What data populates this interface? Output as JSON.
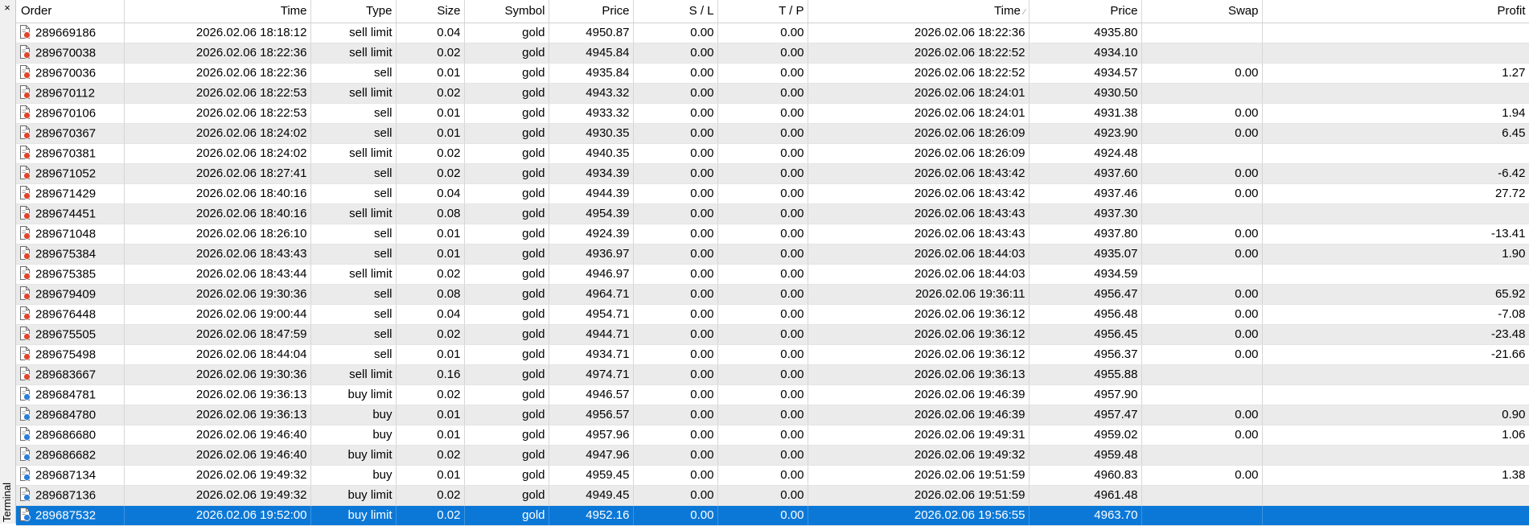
{
  "panel": {
    "close_glyph": "×",
    "side_label": "Terminal"
  },
  "colors": {
    "sell": "#e0462c",
    "buy": "#2b7fd6",
    "selected": "#0b78d7"
  },
  "columns": [
    "Order",
    "Time",
    "Type",
    "Size",
    "Symbol",
    "Price",
    "S / L",
    "T / P",
    "Time",
    "Price",
    "Swap",
    "Profit"
  ],
  "rows": [
    {
      "order": "289669186",
      "time": "2026.02.06 18:18:12",
      "type": "sell limit",
      "size": "0.04",
      "symbol": "gold",
      "price": "4950.87",
      "sl": "0.00",
      "tp": "0.00",
      "close_time": "2026.02.06 18:22:36",
      "close_price": "4935.80",
      "swap": "",
      "profit": "",
      "icon": "sell-order-icon"
    },
    {
      "order": "289670038",
      "time": "2026.02.06 18:22:36",
      "type": "sell limit",
      "size": "0.02",
      "symbol": "gold",
      "price": "4945.84",
      "sl": "0.00",
      "tp": "0.00",
      "close_time": "2026.02.06 18:22:52",
      "close_price": "4934.10",
      "swap": "",
      "profit": "",
      "icon": "sell-order-icon"
    },
    {
      "order": "289670036",
      "time": "2026.02.06 18:22:36",
      "type": "sell",
      "size": "0.01",
      "symbol": "gold",
      "price": "4935.84",
      "sl": "0.00",
      "tp": "0.00",
      "close_time": "2026.02.06 18:22:52",
      "close_price": "4934.57",
      "swap": "0.00",
      "profit": "1.27",
      "icon": "sell-order-icon"
    },
    {
      "order": "289670112",
      "time": "2026.02.06 18:22:53",
      "type": "sell limit",
      "size": "0.02",
      "symbol": "gold",
      "price": "4943.32",
      "sl": "0.00",
      "tp": "0.00",
      "close_time": "2026.02.06 18:24:01",
      "close_price": "4930.50",
      "swap": "",
      "profit": "",
      "icon": "sell-order-icon"
    },
    {
      "order": "289670106",
      "time": "2026.02.06 18:22:53",
      "type": "sell",
      "size": "0.01",
      "symbol": "gold",
      "price": "4933.32",
      "sl": "0.00",
      "tp": "0.00",
      "close_time": "2026.02.06 18:24:01",
      "close_price": "4931.38",
      "swap": "0.00",
      "profit": "1.94",
      "icon": "sell-order-icon"
    },
    {
      "order": "289670367",
      "time": "2026.02.06 18:24:02",
      "type": "sell",
      "size": "0.01",
      "symbol": "gold",
      "price": "4930.35",
      "sl": "0.00",
      "tp": "0.00",
      "close_time": "2026.02.06 18:26:09",
      "close_price": "4923.90",
      "swap": "0.00",
      "profit": "6.45",
      "icon": "sell-order-icon"
    },
    {
      "order": "289670381",
      "time": "2026.02.06 18:24:02",
      "type": "sell limit",
      "size": "0.02",
      "symbol": "gold",
      "price": "4940.35",
      "sl": "0.00",
      "tp": "0.00",
      "close_time": "2026.02.06 18:26:09",
      "close_price": "4924.48",
      "swap": "",
      "profit": "",
      "icon": "sell-order-icon"
    },
    {
      "order": "289671052",
      "time": "2026.02.06 18:27:41",
      "type": "sell",
      "size": "0.02",
      "symbol": "gold",
      "price": "4934.39",
      "sl": "0.00",
      "tp": "0.00",
      "close_time": "2026.02.06 18:43:42",
      "close_price": "4937.60",
      "swap": "0.00",
      "profit": "-6.42",
      "icon": "sell-order-icon"
    },
    {
      "order": "289671429",
      "time": "2026.02.06 18:40:16",
      "type": "sell",
      "size": "0.04",
      "symbol": "gold",
      "price": "4944.39",
      "sl": "0.00",
      "tp": "0.00",
      "close_time": "2026.02.06 18:43:42",
      "close_price": "4937.46",
      "swap": "0.00",
      "profit": "27.72",
      "icon": "sell-order-icon"
    },
    {
      "order": "289674451",
      "time": "2026.02.06 18:40:16",
      "type": "sell limit",
      "size": "0.08",
      "symbol": "gold",
      "price": "4954.39",
      "sl": "0.00",
      "tp": "0.00",
      "close_time": "2026.02.06 18:43:43",
      "close_price": "4937.30",
      "swap": "",
      "profit": "",
      "icon": "sell-order-icon"
    },
    {
      "order": "289671048",
      "time": "2026.02.06 18:26:10",
      "type": "sell",
      "size": "0.01",
      "symbol": "gold",
      "price": "4924.39",
      "sl": "0.00",
      "tp": "0.00",
      "close_time": "2026.02.06 18:43:43",
      "close_price": "4937.80",
      "swap": "0.00",
      "profit": "-13.41",
      "icon": "sell-order-icon"
    },
    {
      "order": "289675384",
      "time": "2026.02.06 18:43:43",
      "type": "sell",
      "size": "0.01",
      "symbol": "gold",
      "price": "4936.97",
      "sl": "0.00",
      "tp": "0.00",
      "close_time": "2026.02.06 18:44:03",
      "close_price": "4935.07",
      "swap": "0.00",
      "profit": "1.90",
      "icon": "sell-order-icon"
    },
    {
      "order": "289675385",
      "time": "2026.02.06 18:43:44",
      "type": "sell limit",
      "size": "0.02",
      "symbol": "gold",
      "price": "4946.97",
      "sl": "0.00",
      "tp": "0.00",
      "close_time": "2026.02.06 18:44:03",
      "close_price": "4934.59",
      "swap": "",
      "profit": "",
      "icon": "sell-order-icon"
    },
    {
      "order": "289679409",
      "time": "2026.02.06 19:30:36",
      "type": "sell",
      "size": "0.08",
      "symbol": "gold",
      "price": "4964.71",
      "sl": "0.00",
      "tp": "0.00",
      "close_time": "2026.02.06 19:36:11",
      "close_price": "4956.47",
      "swap": "0.00",
      "profit": "65.92",
      "icon": "sell-order-icon"
    },
    {
      "order": "289676448",
      "time": "2026.02.06 19:00:44",
      "type": "sell",
      "size": "0.04",
      "symbol": "gold",
      "price": "4954.71",
      "sl": "0.00",
      "tp": "0.00",
      "close_time": "2026.02.06 19:36:12",
      "close_price": "4956.48",
      "swap": "0.00",
      "profit": "-7.08",
      "icon": "sell-order-icon"
    },
    {
      "order": "289675505",
      "time": "2026.02.06 18:47:59",
      "type": "sell",
      "size": "0.02",
      "symbol": "gold",
      "price": "4944.71",
      "sl": "0.00",
      "tp": "0.00",
      "close_time": "2026.02.06 19:36:12",
      "close_price": "4956.45",
      "swap": "0.00",
      "profit": "-23.48",
      "icon": "sell-order-icon"
    },
    {
      "order": "289675498",
      "time": "2026.02.06 18:44:04",
      "type": "sell",
      "size": "0.01",
      "symbol": "gold",
      "price": "4934.71",
      "sl": "0.00",
      "tp": "0.00",
      "close_time": "2026.02.06 19:36:12",
      "close_price": "4956.37",
      "swap": "0.00",
      "profit": "-21.66",
      "icon": "sell-order-icon"
    },
    {
      "order": "289683667",
      "time": "2026.02.06 19:30:36",
      "type": "sell limit",
      "size": "0.16",
      "symbol": "gold",
      "price": "4974.71",
      "sl": "0.00",
      "tp": "0.00",
      "close_time": "2026.02.06 19:36:13",
      "close_price": "4955.88",
      "swap": "",
      "profit": "",
      "icon": "sell-order-icon"
    },
    {
      "order": "289684781",
      "time": "2026.02.06 19:36:13",
      "type": "buy limit",
      "size": "0.02",
      "symbol": "gold",
      "price": "4946.57",
      "sl": "0.00",
      "tp": "0.00",
      "close_time": "2026.02.06 19:46:39",
      "close_price": "4957.90",
      "swap": "",
      "profit": "",
      "icon": "buy-order-icon"
    },
    {
      "order": "289684780",
      "time": "2026.02.06 19:36:13",
      "type": "buy",
      "size": "0.01",
      "symbol": "gold",
      "price": "4956.57",
      "sl": "0.00",
      "tp": "0.00",
      "close_time": "2026.02.06 19:46:39",
      "close_price": "4957.47",
      "swap": "0.00",
      "profit": "0.90",
      "icon": "buy-order-icon"
    },
    {
      "order": "289686680",
      "time": "2026.02.06 19:46:40",
      "type": "buy",
      "size": "0.01",
      "symbol": "gold",
      "price": "4957.96",
      "sl": "0.00",
      "tp": "0.00",
      "close_time": "2026.02.06 19:49:31",
      "close_price": "4959.02",
      "swap": "0.00",
      "profit": "1.06",
      "icon": "buy-order-icon"
    },
    {
      "order": "289686682",
      "time": "2026.02.06 19:46:40",
      "type": "buy limit",
      "size": "0.02",
      "symbol": "gold",
      "price": "4947.96",
      "sl": "0.00",
      "tp": "0.00",
      "close_time": "2026.02.06 19:49:32",
      "close_price": "4959.48",
      "swap": "",
      "profit": "",
      "icon": "buy-order-icon"
    },
    {
      "order": "289687134",
      "time": "2026.02.06 19:49:32",
      "type": "buy",
      "size": "0.01",
      "symbol": "gold",
      "price": "4959.45",
      "sl": "0.00",
      "tp": "0.00",
      "close_time": "2026.02.06 19:51:59",
      "close_price": "4960.83",
      "swap": "0.00",
      "profit": "1.38",
      "icon": "buy-order-icon"
    },
    {
      "order": "289687136",
      "time": "2026.02.06 19:49:32",
      "type": "buy limit",
      "size": "0.02",
      "symbol": "gold",
      "price": "4949.45",
      "sl": "0.00",
      "tp": "0.00",
      "close_time": "2026.02.06 19:51:59",
      "close_price": "4961.48",
      "swap": "",
      "profit": "",
      "icon": "buy-order-icon"
    },
    {
      "order": "289687532",
      "time": "2026.02.06 19:52:00",
      "type": "buy limit",
      "size": "0.02",
      "symbol": "gold",
      "price": "4952.16",
      "sl": "0.00",
      "tp": "0.00",
      "close_time": "2026.02.06 19:56:55",
      "close_price": "4963.70",
      "swap": "",
      "profit": "",
      "icon": "buy-order-icon",
      "selected": true
    }
  ]
}
